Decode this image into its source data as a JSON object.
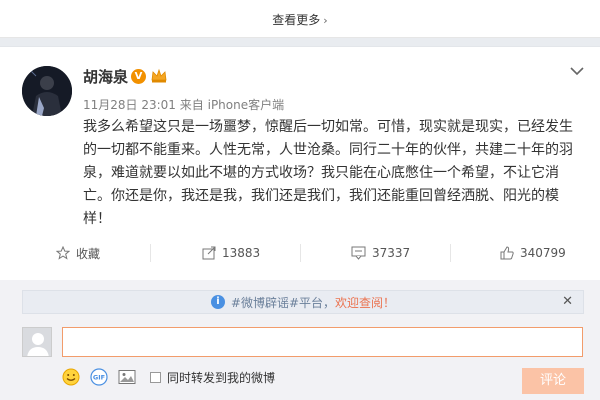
{
  "top": {
    "more_label": "查看更多"
  },
  "post": {
    "author": "胡海泉",
    "time": "11月28日 23:01",
    "source_prefix": "来自",
    "source": "iPhone客户端",
    "content": "我多么希望这只是一场噩梦，惊醒后一切如常。可惜，现实就是现实，已经发生的一切都不能重来。人性无常，人世沧桑。同行二十年的伙伴，共建二十年的羽泉，难道就要以如此不堪的方式收场？我只能在心底憋住一个希望，不让它消亡。你还是你，我还是我，我们还是我们，我们还能重回曾经洒脱、阳光的模样！"
  },
  "actions": {
    "favorite_label": "收藏",
    "repost_count": "13883",
    "comment_count": "37337",
    "like_count": "340799"
  },
  "notice": {
    "hash_text": "#微博辟谣#平台，",
    "link_text": "欢迎查阅！"
  },
  "comment": {
    "input_value": "",
    "sync_label": "同时转发到我的微博",
    "submit_label": "评论"
  },
  "colors": {
    "accent": "#eb7350",
    "submit_disabled": "#fbc3a6",
    "input_border": "#f29c6b",
    "vip_badge": "#f29100",
    "info_icon": "#4a90e2"
  }
}
